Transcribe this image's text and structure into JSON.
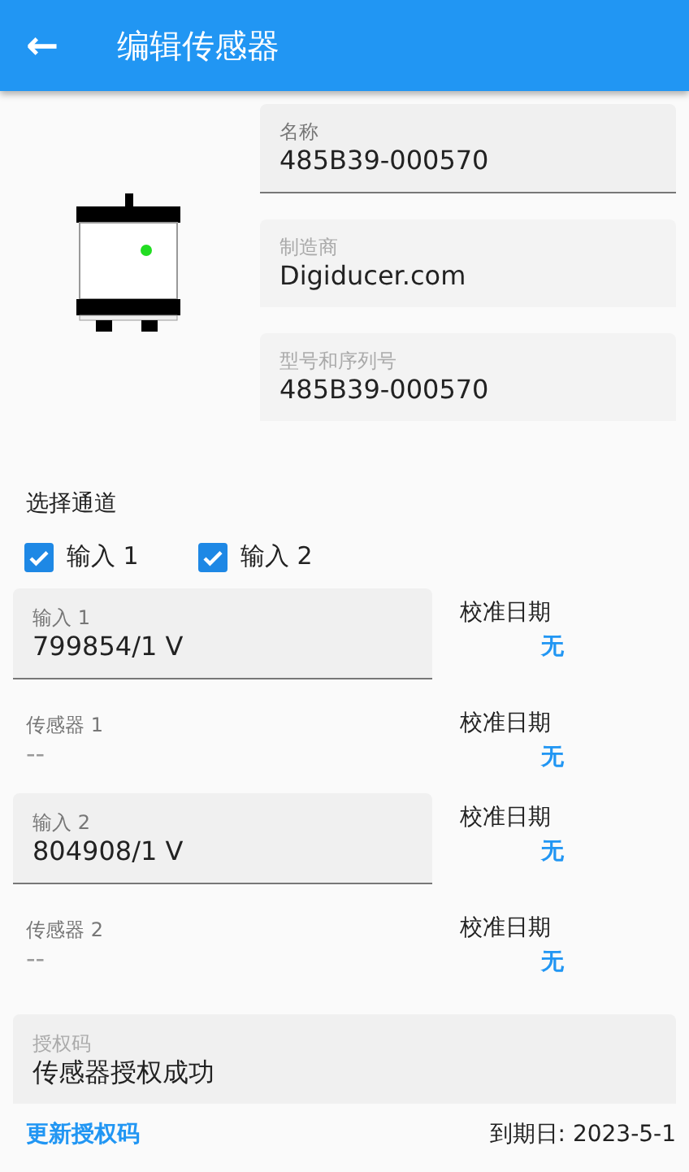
{
  "app_bar": {
    "back": "←",
    "title": "编辑传感器"
  },
  "device_fields": [
    {
      "label": "名称",
      "value": "485B39-000570",
      "disabled": false
    },
    {
      "label": "制造商",
      "value": "Digiducer.com",
      "disabled": true
    },
    {
      "label": "型号和序列号",
      "value": "485B39-000570",
      "disabled": true
    }
  ],
  "channel_select": {
    "title": "选择通道",
    "options": [
      {
        "label": "输入 1",
        "checked": true
      },
      {
        "label": "输入 2",
        "checked": true
      }
    ]
  },
  "channels": [
    {
      "input": {
        "label": "输入 1",
        "value": "799854/1 V"
      },
      "input_calibration": {
        "label": "校准日期",
        "value": "无"
      },
      "sensor": {
        "label": "传感器 1",
        "placeholder": "--"
      },
      "sensor_calibration": {
        "label": "校准日期",
        "value": "无"
      }
    },
    {
      "input": {
        "label": "输入 2",
        "value": "804908/1 V"
      },
      "input_calibration": {
        "label": "校准日期",
        "value": "无"
      },
      "sensor": {
        "label": "传感器 2",
        "placeholder": "--"
      },
      "sensor_calibration": {
        "label": "校准日期",
        "value": "无"
      }
    }
  ],
  "authorization": {
    "label": "授权码",
    "value": "传感器授权成功",
    "update_link": "更新授权码",
    "expiry": "到期日: 2023-5-1"
  }
}
